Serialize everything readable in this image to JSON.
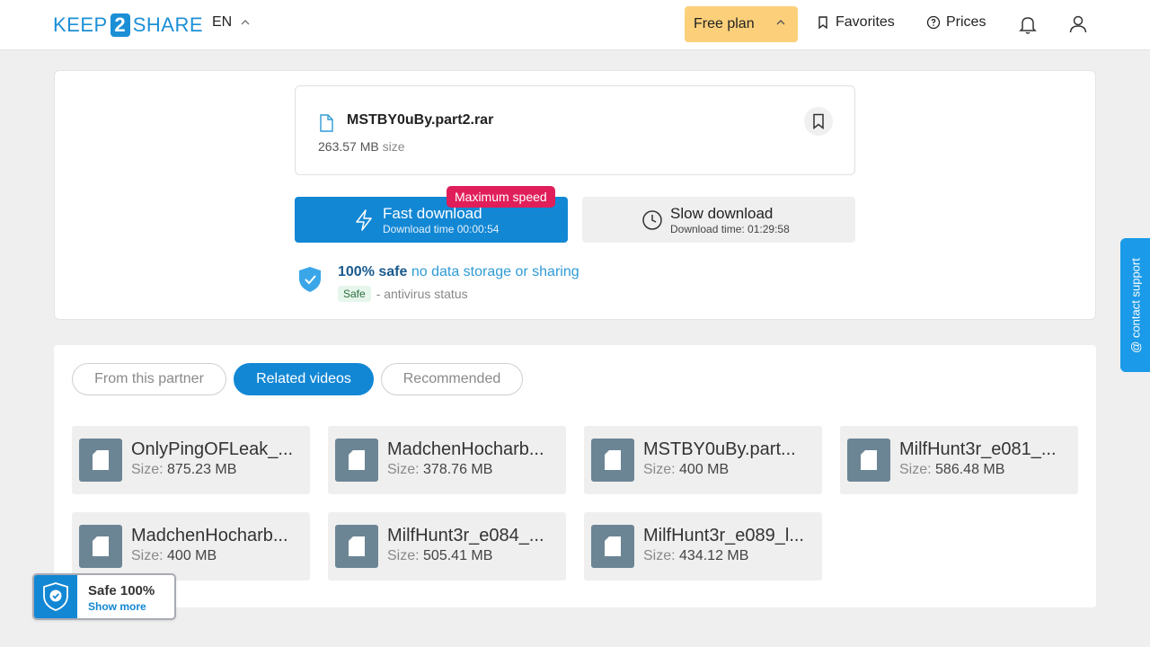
{
  "header": {
    "logo_left": "KEEP",
    "logo_mid": "2",
    "logo_right": "SHARE",
    "language": "EN",
    "plan_label": "Free plan",
    "favorites_label": "Favorites",
    "prices_label": "Prices"
  },
  "file": {
    "name": "MSTBY0uBy.part2.rar",
    "size_value": "263.57 MB",
    "size_label": "size"
  },
  "download": {
    "fast_label": "Fast download",
    "fast_time": "Download time 00:00:54",
    "badge": "Maximum speed",
    "slow_label": "Slow download",
    "slow_time": "Download time: 01:29:58"
  },
  "safety": {
    "bold": "100% safe",
    "note": "no data storage or sharing",
    "status_pill": "Safe",
    "status_text": "- antivirus status"
  },
  "tabs": [
    {
      "label": "From this partner"
    },
    {
      "label": "Related videos"
    },
    {
      "label": "Recommended"
    }
  ],
  "size_prefix": "Size:",
  "files": [
    {
      "name": "OnlyPingOFLeak_...",
      "size": "875.23 MB"
    },
    {
      "name": "MadchenHocharb...",
      "size": "378.76 MB"
    },
    {
      "name": "MSTBY0uBy.part...",
      "size": "400 MB"
    },
    {
      "name": "MilfHunt3r_e081_...",
      "size": "586.48 MB"
    },
    {
      "name": "MadchenHocharb...",
      "size": "400 MB"
    },
    {
      "name": "MilfHunt3r_e084_...",
      "size": "505.41 MB"
    },
    {
      "name": "MilfHunt3r_e089_l...",
      "size": "434.12 MB"
    }
  ],
  "support_label": "@ contact support",
  "safe_widget": {
    "title": "Safe 100%",
    "link": "Show more"
  },
  "colors": {
    "brand": "#1287d4",
    "plan": "#fcd07a",
    "badge": "#e01e5a"
  }
}
